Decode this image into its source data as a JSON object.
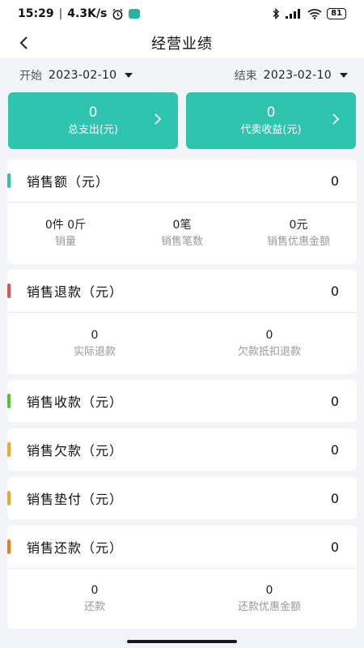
{
  "status": {
    "time": "15:29",
    "speed": "4.3K/s",
    "battery": "81"
  },
  "header": {
    "title": "经营业绩"
  },
  "date_range": {
    "start_label": "开始",
    "start_value": "2023-02-10",
    "end_label": "结束",
    "end_value": "2023-02-10"
  },
  "summary": [
    {
      "value": "0",
      "label": "总支出(元)"
    },
    {
      "value": "0",
      "label": "代卖收益(元)"
    }
  ],
  "sections": [
    {
      "title": "销售额（元）",
      "total": "0",
      "color": "#2ec4b0",
      "stats": [
        {
          "value": "0件 0斤",
          "label": "销量"
        },
        {
          "value": "0笔",
          "label": "销售笔数"
        },
        {
          "value": "0元",
          "label": "销售优惠金额"
        }
      ]
    },
    {
      "title": "销售退款（元）",
      "total": "0",
      "color": "#e84d4d",
      "stats": [
        {
          "value": "0",
          "label": "实际退款"
        },
        {
          "value": "0",
          "label": "欠款抵扣退款"
        }
      ]
    },
    {
      "title": "销售收款（元）",
      "total": "0",
      "color": "#57c22f"
    },
    {
      "title": "销售欠款（元）",
      "total": "0",
      "color": "#f5a623"
    },
    {
      "title": "销售垫付（元）",
      "total": "0",
      "color": "#f5a623"
    },
    {
      "title": "销售还款（元）",
      "total": "0",
      "color": "#f07a1a",
      "stats": [
        {
          "value": "0",
          "label": "还款"
        },
        {
          "value": "0",
          "label": "还款优惠金额"
        }
      ]
    }
  ]
}
